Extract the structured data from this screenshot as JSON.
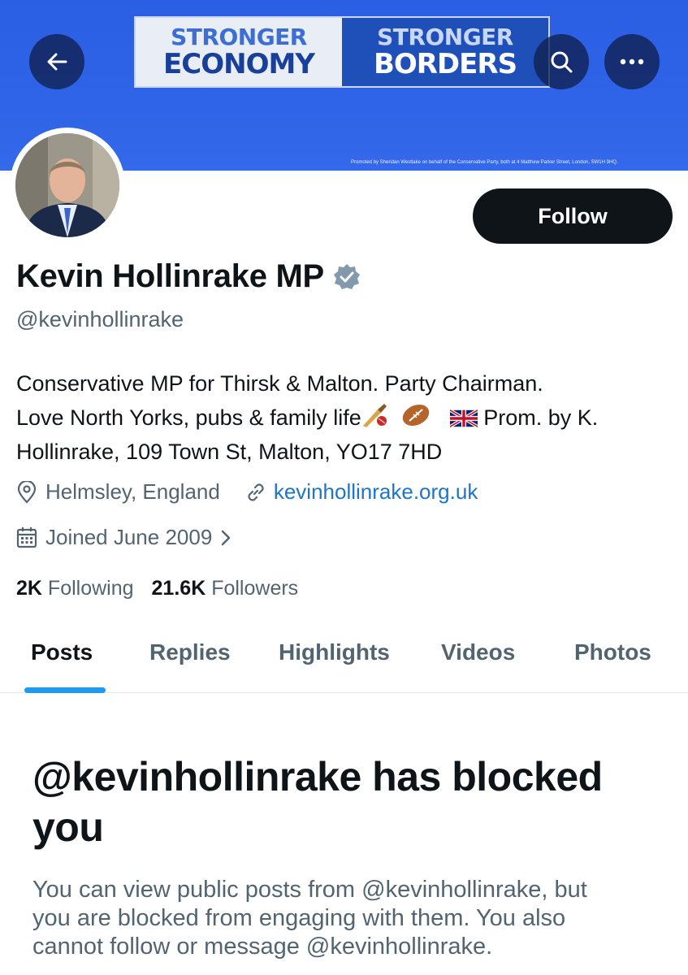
{
  "banner": {
    "sign_left_top": "STRONGER",
    "sign_left_bottom": "ECONOMY",
    "sign_right_top": "STRONGER",
    "sign_right_bottom": "BORDERS",
    "promoted_text": "Promoted by Sheridan Westlake on behalf of the Conservative Party, both at 4 Matthew Parker Street, London, SW1H 9HQ."
  },
  "icons": {
    "back": "back-arrow-icon",
    "search": "search-icon",
    "more": "more-icon",
    "verified": "verified-badge-icon",
    "location": "location-pin-icon",
    "link": "link-icon",
    "calendar": "calendar-icon",
    "chevron": "chevron-right-icon",
    "cricket": "cricket-emoji",
    "rugby": "rugby-ball-emoji",
    "flag": "uk-flag-emoji"
  },
  "profile": {
    "display_name": "Kevin Hollinrake MP",
    "handle": "@kevinhollinrake",
    "follow_label": "Follow",
    "bio_line1": "Conservative MP for Thirsk & Malton. Party Chairman.",
    "bio_line2a": "Love North Yorks, pubs & family life",
    "bio_line2b": " Prom. by K.",
    "bio_line3": "Hollinrake, 109 Town St, Malton, YO17 7HD",
    "location": "Helmsley, England",
    "website": "kevinhollinrake.org.uk",
    "joined": "Joined June 2009",
    "following_count": "2K",
    "following_label": "Following",
    "followers_count": "21.6K",
    "followers_label": "Followers"
  },
  "tabs": [
    {
      "label": "Posts",
      "active": true
    },
    {
      "label": "Replies",
      "active": false
    },
    {
      "label": "Highlights",
      "active": false
    },
    {
      "label": "Videos",
      "active": false
    },
    {
      "label": "Photos",
      "active": false
    }
  ],
  "blocked": {
    "title_line1": "@kevinhollinrake has blocked",
    "title_line2": "you",
    "desc_line1": "You can view public posts from @kevinhollinrake, but",
    "desc_line2": "you are blocked from engaging with them. You also",
    "desc_line3": "cannot follow or message @kevinhollinrake."
  },
  "colors": {
    "banner_blue": "#2f64e8",
    "link_blue": "#1d75c9",
    "accent": "#1d9bf0",
    "text_primary": "#0f1419",
    "text_secondary": "#536471"
  }
}
